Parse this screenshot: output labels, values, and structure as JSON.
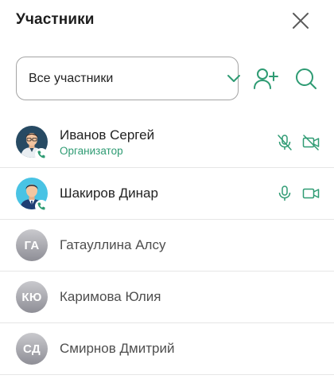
{
  "header": {
    "title": "Участники"
  },
  "filter": {
    "selected": "Все участники"
  },
  "colors": {
    "accent": "#2e9b73",
    "avatar_gray": "#a0a0a6"
  },
  "participants": [
    {
      "name": "Иванов Сергей",
      "role": "Организатор",
      "in_call": true,
      "mic": "muted",
      "camera": "off"
    },
    {
      "name": "Шакиров Динар",
      "in_call": true,
      "mic": "on",
      "camera": "on"
    },
    {
      "name": "Гатауллина Алсу",
      "initials": "ГА"
    },
    {
      "name": "Каримова Юлия",
      "initials": "КЮ"
    },
    {
      "name": "Смирнов Дмитрий",
      "initials": "СД"
    }
  ]
}
